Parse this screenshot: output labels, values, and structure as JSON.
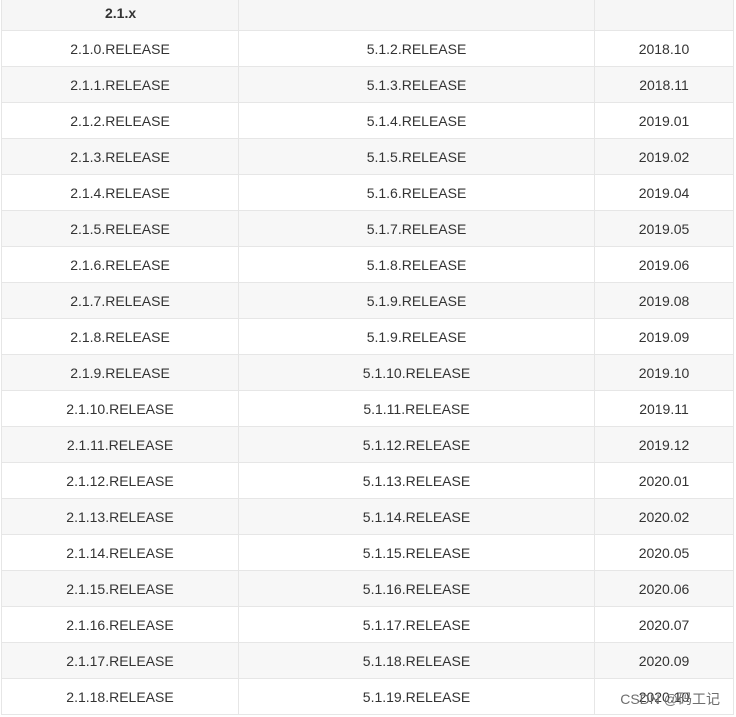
{
  "section_label": "2.1.x",
  "rows": [
    [
      "2.1.0.RELEASE",
      "5.1.2.RELEASE",
      "2018.10"
    ],
    [
      "2.1.1.RELEASE",
      "5.1.3.RELEASE",
      "2018.11"
    ],
    [
      "2.1.2.RELEASE",
      "5.1.4.RELEASE",
      "2019.01"
    ],
    [
      "2.1.3.RELEASE",
      "5.1.5.RELEASE",
      "2019.02"
    ],
    [
      "2.1.4.RELEASE",
      "5.1.6.RELEASE",
      "2019.04"
    ],
    [
      "2.1.5.RELEASE",
      "5.1.7.RELEASE",
      "2019.05"
    ],
    [
      "2.1.6.RELEASE",
      "5.1.8.RELEASE",
      "2019.06"
    ],
    [
      "2.1.7.RELEASE",
      "5.1.9.RELEASE",
      "2019.08"
    ],
    [
      "2.1.8.RELEASE",
      "5.1.9.RELEASE",
      "2019.09"
    ],
    [
      "2.1.9.RELEASE",
      "5.1.10.RELEASE",
      "2019.10"
    ],
    [
      "2.1.10.RELEASE",
      "5.1.11.RELEASE",
      "2019.11"
    ],
    [
      "2.1.11.RELEASE",
      "5.1.12.RELEASE",
      "2019.12"
    ],
    [
      "2.1.12.RELEASE",
      "5.1.13.RELEASE",
      "2020.01"
    ],
    [
      "2.1.13.RELEASE",
      "5.1.14.RELEASE",
      "2020.02"
    ],
    [
      "2.1.14.RELEASE",
      "5.1.15.RELEASE",
      "2020.05"
    ],
    [
      "2.1.15.RELEASE",
      "5.1.16.RELEASE",
      "2020.06"
    ],
    [
      "2.1.16.RELEASE",
      "5.1.17.RELEASE",
      "2020.07"
    ],
    [
      "2.1.17.RELEASE",
      "5.1.18.RELEASE",
      "2020.09"
    ],
    [
      "2.1.18.RELEASE",
      "5.1.19.RELEASE",
      "2020.10"
    ]
  ],
  "watermark": "CSDN @码工记"
}
